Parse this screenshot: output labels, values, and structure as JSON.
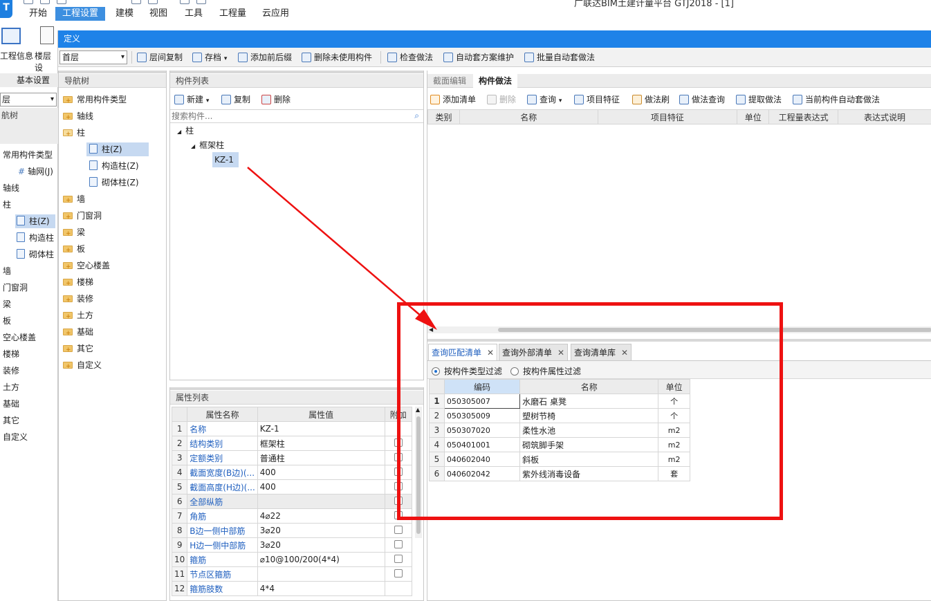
{
  "app": {
    "title": "广联达BIM土建计量平台 GTJ2018 - [1]",
    "logo": "T"
  },
  "ribbon": {
    "tabs": [
      "开始",
      "工程设置",
      "建模",
      "视图",
      "工具",
      "工程量",
      "云应用"
    ],
    "active_tab": "工程设置",
    "big_buttons": [
      "工程信息",
      "楼层设"
    ],
    "group_label": "基本设置"
  },
  "left_partial": {
    "floor_value": "层",
    "nav_label": "航树",
    "items": [
      "常用构件类型",
      "轴网(J)",
      "轴线",
      "柱",
      "柱(Z)",
      "构造柱",
      "砌体柱",
      "墙",
      "门窗洞",
      "梁",
      "板",
      "空心楼盖",
      "楼梯",
      "装修",
      "土方",
      "基础",
      "其它",
      "自定义"
    ]
  },
  "definition": {
    "title": "定义",
    "floor_select": "首层",
    "toolbar": {
      "copy_floor": "层间复制",
      "save": "存档",
      "add_prefix": "添加前后缀",
      "delete_unused": "删除未使用构件",
      "check_method": "检查做法",
      "auto_maintain": "自动套方案维护",
      "batch_auto": "批量自动套做法"
    }
  },
  "nav_tree": {
    "title": "导航树",
    "items": [
      "常用构件类型",
      "轴线",
      "柱",
      "柱(Z)",
      "构造柱(Z)",
      "砌体柱(Z)",
      "墙",
      "门窗洞",
      "梁",
      "板",
      "空心楼盖",
      "楼梯",
      "装修",
      "土方",
      "基础",
      "其它",
      "自定义"
    ]
  },
  "component_list": {
    "title": "构件列表",
    "new_label": "新建",
    "copy_label": "复制",
    "delete_label": "删除",
    "search_placeholder": "搜索构件...",
    "tree": [
      "柱",
      "框架柱",
      "KZ-1"
    ]
  },
  "properties": {
    "title": "属性列表",
    "headers": [
      "属性名称",
      "属性值",
      "附加"
    ],
    "rows": [
      {
        "n": "1",
        "name": "名称",
        "value": "KZ-1",
        "chk": false
      },
      {
        "n": "2",
        "name": "结构类别",
        "value": "框架柱",
        "chk": true
      },
      {
        "n": "3",
        "name": "定额类别",
        "value": "普通柱",
        "chk": true
      },
      {
        "n": "4",
        "name": "截面宽度(B边)(...",
        "value": "400",
        "chk": true
      },
      {
        "n": "5",
        "name": "截面高度(H边)(...",
        "value": "400",
        "chk": true
      },
      {
        "n": "6",
        "name": "全部纵筋",
        "value": "",
        "chk": true
      },
      {
        "n": "7",
        "name": "角筋",
        "value": "4⌀22",
        "chk": true
      },
      {
        "n": "8",
        "name": "B边一侧中部筋",
        "value": "3⌀20",
        "chk": true
      },
      {
        "n": "9",
        "name": "H边一侧中部筋",
        "value": "3⌀20",
        "chk": true
      },
      {
        "n": "10",
        "name": "箍筋",
        "value": "⌀10@100/200(4*4)",
        "chk": true
      },
      {
        "n": "11",
        "name": "节点区箍筋",
        "value": "",
        "chk": true
      },
      {
        "n": "12",
        "name": "箍筋肢数",
        "value": "4*4",
        "chk": false
      }
    ]
  },
  "method": {
    "tabs": [
      "截面编辑",
      "构件做法"
    ],
    "active_tab": "构件做法",
    "toolbar": [
      "添加清单",
      "删除",
      "查询",
      "项目特征",
      "做法刷",
      "做法查询",
      "提取做法",
      "当前构件自动套做法"
    ],
    "headers": [
      "类别",
      "名称",
      "项目特征",
      "单位",
      "工程量表达式",
      "表达式说明"
    ]
  },
  "query": {
    "tabs": [
      "查询匹配清单",
      "查询外部清单",
      "查询清单库"
    ],
    "active_tab": "查询匹配清单",
    "filter_options": [
      "按构件类型过滤",
      "按构件属性过滤"
    ],
    "headers": [
      "编码",
      "名称",
      "单位"
    ],
    "rows": [
      {
        "n": "1",
        "code": "050305007",
        "name": "水磨石 桌凳",
        "unit": "个"
      },
      {
        "n": "2",
        "code": "050305009",
        "name": "塑树节椅",
        "unit": "个"
      },
      {
        "n": "3",
        "code": "050307020",
        "name": "柔性水池",
        "unit": "m2"
      },
      {
        "n": "4",
        "code": "050401001",
        "name": "砌筑脚手架",
        "unit": "m2"
      },
      {
        "n": "5",
        "code": "040602040",
        "name": "斜板",
        "unit": "m2"
      },
      {
        "n": "6",
        "code": "040602042",
        "name": "紫外线消毒设备",
        "unit": "套"
      }
    ]
  },
  "colors": {
    "accent": "#1e82e8",
    "annotation": "#ee1111",
    "link": "#1f5fbf"
  }
}
